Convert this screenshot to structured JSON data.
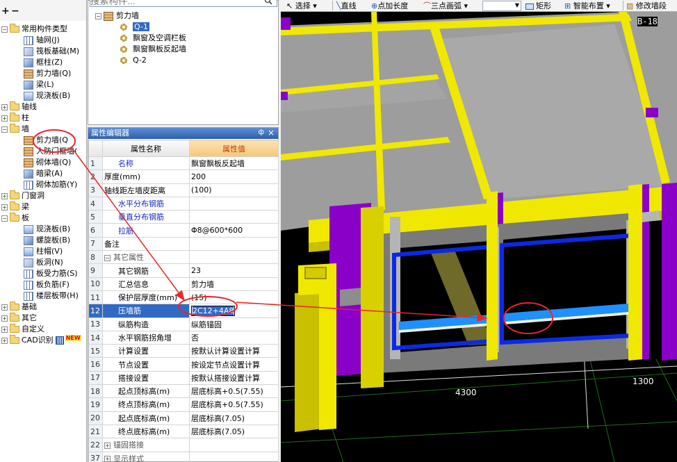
{
  "left_toolbar": {
    "expand_label": "+",
    "collapse_label": "−"
  },
  "tree": {
    "common_types": "常用构件类型",
    "common_items": [
      "轴网(J)",
      "筏板基础(M)",
      "框柱(Z)",
      "剪力墙(Q)",
      "梁(L)",
      "现浇板(B)"
    ],
    "axis": "轴线",
    "column": "柱",
    "wall": "墙",
    "wall_items": [
      "剪力墙(Q",
      "人防门框墙(",
      "砌体墙(Q)",
      "暗梁(A)",
      "砌体加筋(Y)"
    ],
    "door_window": "门窗洞",
    "beam": "梁",
    "slab": "板",
    "slab_items": [
      "现浇板(B)",
      "螺旋板(B)",
      "柱帽(V)",
      "板洞(N)",
      "板受力筋(S)",
      "板负筋(F)",
      "楼层板带(H)"
    ],
    "foundation": "基础",
    "other": "其它",
    "custom": "自定义",
    "cad": "CAD识别",
    "cad_badge": "NEW"
  },
  "component_list": {
    "search_placeholder": "搜索构件...",
    "root": "剪力墙",
    "items": [
      "Q-1",
      "飘窗及空调栏板",
      "飘窗飘板反起墙",
      "Q-2"
    ],
    "selected_index": 0
  },
  "prop_editor": {
    "title": "属性编辑器",
    "pin": "ф",
    "close": "×",
    "col_name": "属性名称",
    "col_value": "属性值",
    "rows": [
      {
        "n": "1",
        "name": "名称",
        "value": "飘窗飘板反起墙",
        "style": "blue"
      },
      {
        "n": "2",
        "name": "厚度(mm)",
        "value": "200",
        "style": ""
      },
      {
        "n": "3",
        "name": "轴线距左墙皮距离",
        "value": "(100)",
        "style": ""
      },
      {
        "n": "4",
        "name": "水平分布钢筋",
        "value": "",
        "style": "blue"
      },
      {
        "n": "5",
        "name": "垂直分布钢筋",
        "value": "",
        "style": "blue"
      },
      {
        "n": "6",
        "name": "拉筋",
        "value": "Φ8@600*600",
        "style": "blue"
      },
      {
        "n": "7",
        "name": "备注",
        "value": "",
        "style": ""
      },
      {
        "n": "8",
        "name": "其它属性",
        "value": "",
        "style": "group"
      },
      {
        "n": "9",
        "name": "其它钢筋",
        "value": "23",
        "style": "indent"
      },
      {
        "n": "10",
        "name": "汇总信息",
        "value": "剪力墙",
        "style": "indent"
      },
      {
        "n": "11",
        "name": "保护层厚度(mm)",
        "value": "(15)",
        "style": "indent"
      },
      {
        "n": "12",
        "name": "压墙筋",
        "value": "2C12+4A8",
        "style": "highlight"
      },
      {
        "n": "13",
        "name": "纵筋构造",
        "value": "纵筋锚固",
        "style": "indent"
      },
      {
        "n": "14",
        "name": "水平钢筋拐角增",
        "value": "否",
        "style": "indent"
      },
      {
        "n": "15",
        "name": "计算设置",
        "value": "按默认计算设置计算",
        "style": "indent"
      },
      {
        "n": "16",
        "name": "节点设置",
        "value": "按设定节点设置计算",
        "style": "indent"
      },
      {
        "n": "17",
        "name": "搭接设置",
        "value": "按默认搭接设置计算",
        "style": "indent"
      },
      {
        "n": "18",
        "name": "起点顶标高(m)",
        "value": "层底标高+0.5(7.55)",
        "style": "indent"
      },
      {
        "n": "19",
        "name": "终点顶标高(m)",
        "value": "层底标高+0.5(7.55)",
        "style": "indent"
      },
      {
        "n": "20",
        "name": "起点底标高(m)",
        "value": "层底标高(7.05)",
        "style": "indent"
      },
      {
        "n": "21",
        "name": "终点底标高(m)",
        "value": "层底标高(7.05)",
        "style": "indent"
      },
      {
        "n": "22",
        "name": "锚固搭接",
        "value": "",
        "style": "group"
      },
      {
        "n": "37",
        "name": "显示样式",
        "value": "",
        "style": "group"
      }
    ]
  },
  "view_toolbar": {
    "select": "选择",
    "line": "直线",
    "point_length": "点加长度",
    "arc": "三点画弧",
    "rect": "矩形",
    "smart_place": "智能布置",
    "modify": "修改墙段"
  },
  "viewport": {
    "axis_tag": "B-18",
    "dim_left": "4300",
    "dim_right": "1300"
  },
  "colors": {
    "wall_yellow": "#f0e800",
    "column_purple": "#8a00c8",
    "slab_gray": "#9d9d9d",
    "rebar_blue": "#0a2ae6",
    "annotation_red": "#e8262a",
    "grid_green": "#1f6b1f"
  }
}
